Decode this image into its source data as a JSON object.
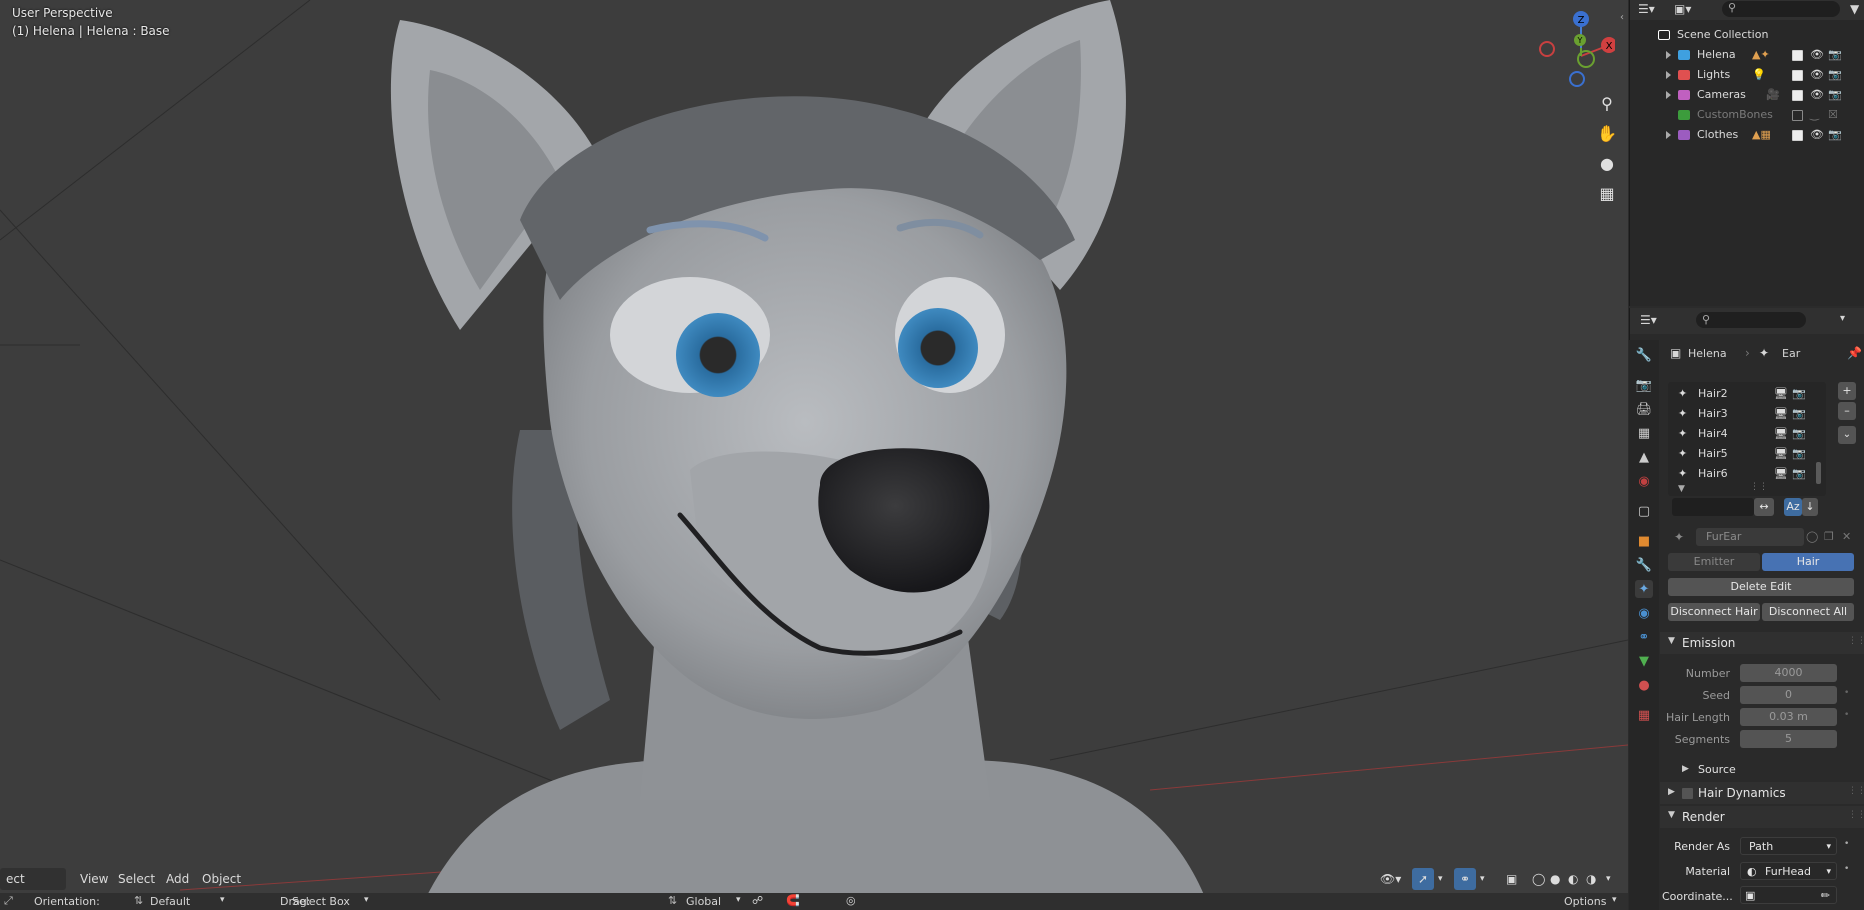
{
  "viewport": {
    "perspective_label": "User Perspective",
    "object_label": "(1) Helena | Helena : Base",
    "gizmo": {
      "x": "X",
      "y": "Y",
      "z": "Z"
    },
    "header": {
      "mode": "ect Mode",
      "menus": [
        "View",
        "Select",
        "Add",
        "Object"
      ]
    },
    "tool_header": {
      "orientation_label": "Orientation:",
      "orientation_value": "Default",
      "drag_label": "Drag:",
      "drag_value": "Select Box",
      "transform": "Global",
      "options": "Options"
    }
  },
  "outliner": {
    "root": "Scene Collection",
    "items": [
      {
        "name": "Helena",
        "color": "#3fa0e0",
        "enabled": true
      },
      {
        "name": "Lights",
        "color": "#e05050",
        "enabled": true
      },
      {
        "name": "Cameras",
        "color": "#c060c0",
        "enabled": true
      },
      {
        "name": "CustomBones",
        "color": "#3c9c3c",
        "enabled": false
      },
      {
        "name": "Clothes",
        "color": "#9c5cc0",
        "enabled": true
      }
    ]
  },
  "properties": {
    "breadcrumb": {
      "object": "Helena",
      "system": "Ear"
    },
    "particle_systems": [
      "Hair2",
      "Hair3",
      "Hair4",
      "Hair5",
      "Hair6"
    ],
    "settings_name": "FurEar",
    "type_tabs": [
      "Emitter",
      "Hair"
    ],
    "active_type": "Hair",
    "delete_edit": "Delete Edit",
    "disconnect_hair": "Disconnect Hair",
    "disconnect_all": "Disconnect All",
    "emission": {
      "title": "Emission",
      "fields": [
        {
          "label": "Number",
          "value": "4000"
        },
        {
          "label": "Seed",
          "value": "0"
        },
        {
          "label": "Hair Length",
          "value": "0.03 m"
        },
        {
          "label": "Segments",
          "value": "5"
        }
      ],
      "source": "Source"
    },
    "hair_dynamics": "Hair Dynamics",
    "render": {
      "title": "Render",
      "render_as_label": "Render As",
      "render_as_value": "Path",
      "material_label": "Material",
      "material_value": "FurHead",
      "coordinate_label": "Coordinate..."
    }
  }
}
